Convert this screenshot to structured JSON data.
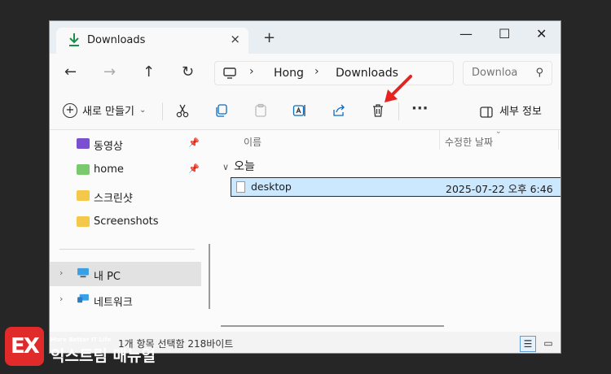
{
  "window": {
    "tab_title": "Downloads",
    "tab_close": "×",
    "new_tab": "+",
    "minimize": "—",
    "maximize": "☐",
    "close": "✕"
  },
  "nav_buttons": {
    "back": "←",
    "forward": "→",
    "up": "↑",
    "refresh": "↻"
  },
  "address": {
    "crumbs": [
      "Hong",
      "Downloads"
    ],
    "separator": "›"
  },
  "search": {
    "placeholder": "Downloa"
  },
  "toolbar": {
    "new_label": "새로 만들기",
    "more": "···",
    "details_label": "세부 정보"
  },
  "sidebar": {
    "items": [
      {
        "label": "동영상",
        "pinned": true
      },
      {
        "label": "home",
        "pinned": true
      },
      {
        "label": "스크린샷",
        "pinned": false
      },
      {
        "label": "Screenshots",
        "pinned": false
      },
      {
        "label": "내 PC",
        "selected": true
      },
      {
        "label": "네트워크"
      }
    ]
  },
  "columns": {
    "name": "이름",
    "modified": "수정한 날짜"
  },
  "group": {
    "label": "오늘"
  },
  "files": [
    {
      "name": "desktop",
      "modified": "2025-07-22 오후 6:46"
    }
  ],
  "status": {
    "text": "1개 항목 선택함 218바이트"
  },
  "logo": {
    "tagline": "More Better IT Life",
    "name": "익스트림 매뉴얼",
    "mark": "EX"
  },
  "colors": {
    "selection": "#cce8ff",
    "accent_arrow": "#e8231f",
    "logo_red": "#e12a2a"
  }
}
